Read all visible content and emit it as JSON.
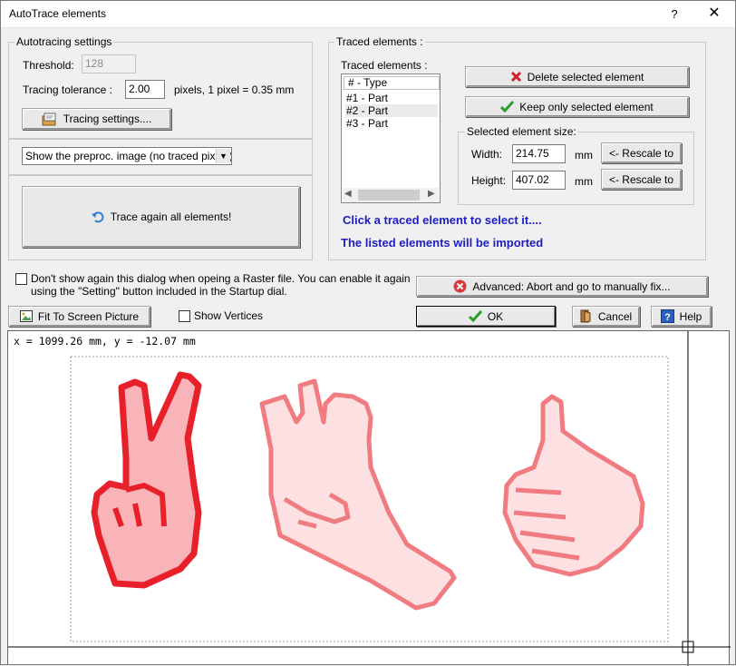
{
  "window": {
    "title": "AutoTrace elements",
    "help_glyph": "?",
    "close_glyph": "✕"
  },
  "autotracing": {
    "legend": "Autotracing settings",
    "threshold_label": "Threshold:",
    "threshold_value": "128",
    "tolerance_label": "Tracing tolerance :",
    "tolerance_value": "2.00",
    "tolerance_unit": "pixels, 1 pixel = 0.35 mm",
    "tracing_settings_button": "Tracing settings...."
  },
  "preview_select": {
    "value": "Show the preproc. image (no traced pixels)"
  },
  "trace_again_button": "Trace again all elements!",
  "traced": {
    "legend": "Traced elements :",
    "list_label": "Traced elements :",
    "list_header": "# - Type",
    "items": [
      "#1 - Part",
      "#2 - Part",
      "#3 - Part"
    ],
    "delete_button": "Delete selected element",
    "keep_button": "Keep only selected element",
    "size_legend": "Selected element size:",
    "width_label": "Width:",
    "width_value": "214.75",
    "width_unit": "mm",
    "height_label": "Height:",
    "height_value": "407.02",
    "height_unit": "mm",
    "rescale_label": "<- Rescale to",
    "msg1": "Click a traced element to select it....",
    "msg2": "The listed elements will be imported"
  },
  "dont_show": {
    "text_line1": "Don't show again this dialog when opeing a Raster file. You can enable it again",
    "text_line2": "using the \"Setting\" button included in the Startup dial."
  },
  "advanced_button": "Advanced: Abort and go to manually fix...",
  "fit_button": "Fit To Screen Picture",
  "show_vertices_label": "Show Vertices",
  "ok_button": "OK",
  "cancel_button": "Cancel",
  "help_button": "Help",
  "canvas": {
    "coord_readout": "x = 1099.26 mm, y = -12.07 mm"
  },
  "colors": {
    "trace_selected": "#e8202a",
    "trace_fill": "#f8b4b8",
    "trace_unselected": "#f07c82",
    "message_blue": "#1d1dc4"
  }
}
